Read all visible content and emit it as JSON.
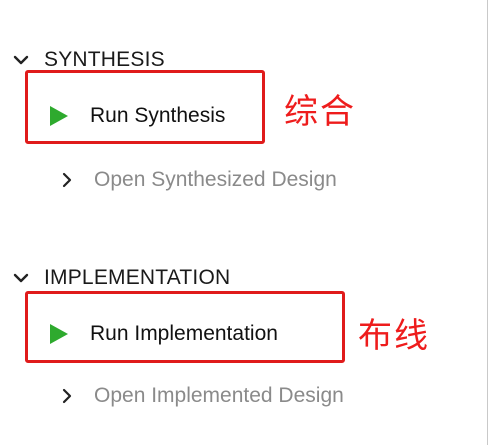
{
  "sections": {
    "synthesis": {
      "header": "SYNTHESIS",
      "run_label": "Run Synthesis",
      "open_label": "Open Synthesized Design",
      "annotation": "综合"
    },
    "implementation": {
      "header": "IMPLEMENTATION",
      "run_label": "Run Implementation",
      "open_label": "Open Implemented Design",
      "annotation": "布线"
    }
  },
  "colors": {
    "run_icon": "#2eaa2e",
    "highlight": "#e01b1b",
    "annotation_text": "#ee1c1c",
    "disabled_text": "#8a8a8a"
  },
  "icons": {
    "section_toggle": "chevron-down-icon",
    "run": "play-icon",
    "open": "chevron-right-icon"
  }
}
